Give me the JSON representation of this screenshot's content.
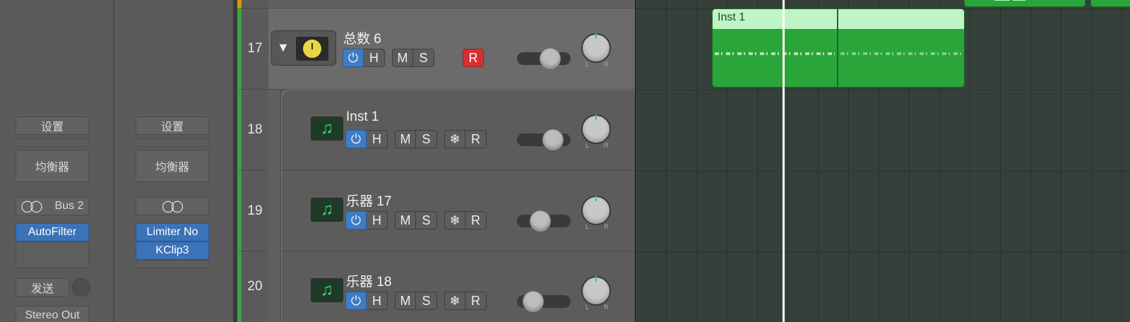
{
  "inspector": {
    "strip_a": {
      "settings_label": "设置",
      "eq_label": "均衡器",
      "output_label": "Bus 2",
      "plugins": [
        "AutoFilter"
      ],
      "sends_label": "发送",
      "io_label": "Stereo Out"
    },
    "strip_b": {
      "settings_label": "设置",
      "eq_label": "均衡器",
      "plugins": [
        "Limiter No",
        "KClip3"
      ]
    }
  },
  "tracks": [
    {
      "number": "17",
      "name": "总数 6",
      "type": "summing-stack"
    },
    {
      "number": "18",
      "name": "Inst 1",
      "type": "software-instrument"
    },
    {
      "number": "19",
      "name": "乐器 17",
      "type": "software-instrument"
    },
    {
      "number": "20",
      "name": "乐器 18",
      "type": "software-instrument"
    }
  ],
  "buttons": {
    "hide": "H",
    "mute": "M",
    "solo": "S",
    "record": "R",
    "freeze": "❄",
    "power": "⏻"
  },
  "pan_labels": {
    "left": "L",
    "right": "R"
  },
  "regions": [
    {
      "name": "Inst 1"
    }
  ],
  "colors": {
    "track_green": "#2fa74a",
    "region_green": "#2aa53a",
    "region_header": "#bff5c6",
    "power_blue": "#3f7cc6",
    "record_red": "#d43030",
    "plugin_blue": "#3b73b8",
    "stack_yellow": "#e9d642"
  }
}
